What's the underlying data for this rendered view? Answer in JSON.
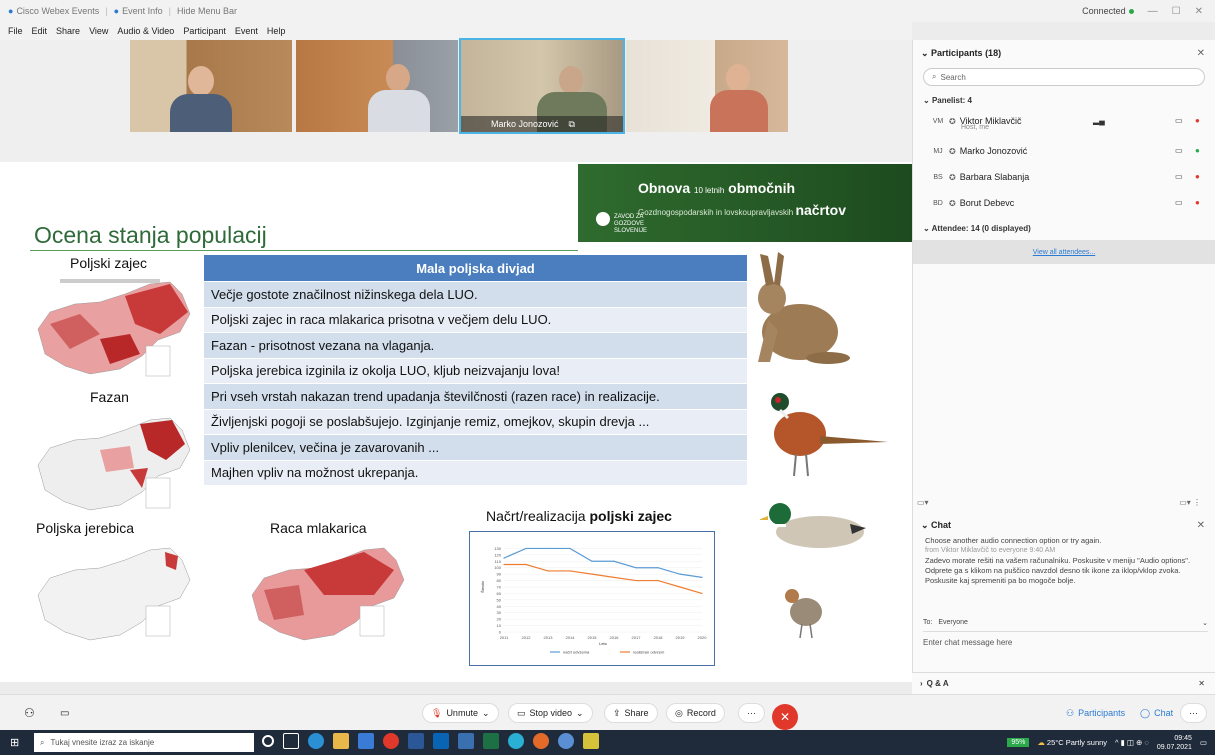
{
  "titlebar": {
    "app": "Cisco Webex Events",
    "event_info": "Event Info",
    "hide_menu": "Hide Menu Bar",
    "connection": "Connected"
  },
  "menu": [
    "File",
    "Edit",
    "Share",
    "View",
    "Audio & Video",
    "Participant",
    "Event",
    "Help"
  ],
  "videos": [
    {
      "name": ""
    },
    {
      "name": ""
    },
    {
      "name": "Marko Jonozović"
    },
    {
      "name": ""
    }
  ],
  "slide": {
    "banner": {
      "line1_a": "Obnova",
      "line1_b": "10 letnih",
      "line1_c": "območnih",
      "line2_a": "Gozdnogospodarskih in lovskoupravljavskih",
      "line2_b": "načrtov",
      "logo_text": "ZAVOD ZA GOZDOVE SLOVENIJE"
    },
    "title": "Ocena stanja populacij",
    "maps": [
      "Poljski zajec",
      "Fazan",
      "Poljska jerebica",
      "Raca mlakarica"
    ],
    "table_header": "Mala poljska divjad",
    "rows": [
      "Večje gostote značilnost nižinskega dela LUO.",
      "Poljski zajec in raca mlakarica prisotna v večjem delu LUO.",
      "Fazan - prisotnost vezana na vlaganja.",
      "Poljska jerebica izginila iz okolja LUO, kljub neizvajanju lova!",
      "Pri vseh vrstah nakazan trend upadanja številčnosti (razen race) in realizacije.",
      "Življenjski pogoji se poslabšujejo. Izginjanje remiz, omejkov, skupin drevja ...",
      "Vpliv plenilcev, večina je zavarovanih ...",
      "Majhen vpliv na možnost ukrepanja."
    ],
    "chart_title_a": "Načrt/realizacija",
    "chart_title_b": "poljski zajec"
  },
  "chart_data": {
    "type": "line",
    "title": "Načrt/realizacija poljski zajec",
    "xlabel": "Leto",
    "ylabel": "Število",
    "x": [
      2011,
      2012,
      2013,
      2014,
      2015,
      2016,
      2017,
      2018,
      2019,
      2020
    ],
    "ylim": [
      0,
      140
    ],
    "yticks": [
      0,
      10,
      20,
      30,
      40,
      50,
      60,
      70,
      80,
      90,
      100,
      110,
      120,
      130
    ],
    "series": [
      {
        "name": "načrt odvzema",
        "color": "#5b9bd5",
        "values": [
          115,
          130,
          130,
          130,
          110,
          110,
          100,
          100,
          90,
          85
        ]
      },
      {
        "name": "realiziran odvzem",
        "color": "#ed7d31",
        "values": [
          105,
          105,
          95,
          95,
          90,
          85,
          80,
          80,
          70,
          60
        ]
      }
    ]
  },
  "panel": {
    "participants_title": "Participants (18)",
    "search_placeholder": "Search",
    "panelist_label": "Panelist: 4",
    "panelists": [
      {
        "initials": "VM",
        "name": "Viktor Miklavčič",
        "sub": "Host, me"
      },
      {
        "initials": "MJ",
        "name": "Marko Jonozović",
        "sub": ""
      },
      {
        "initials": "BS",
        "name": "Barbara Slabanja",
        "sub": ""
      },
      {
        "initials": "BD",
        "name": "Borut Debevc",
        "sub": ""
      }
    ],
    "attendee_label": "Attendee: 14 (0 displayed)",
    "view_all": "View all attendees...",
    "chat_title": "Chat",
    "chat_line1": "Choose another audio connection option or try again.",
    "chat_meta": "from Viktor Miklavčič to everyone   9:40 AM",
    "chat_msg": "Zadevo morate rešiti na vašem računalniku. Poskusite v meniju \"Audio options\". Odprete ga s klikom na puščico navzdol desno tik ikone za iklop/vklop zvoka. Poskusite kaj spremeniti pa bo mogoče bolje.",
    "to_label": "To:",
    "to_value": "Everyone",
    "chat_placeholder": "Enter chat message here",
    "qa_label": "Q & A"
  },
  "toolbar": {
    "unmute": "Unmute",
    "stop_video": "Stop video",
    "share": "Share",
    "record": "Record",
    "participants": "Participants",
    "chat": "Chat"
  },
  "taskbar": {
    "search": "Tukaj vnesite izraz za iskanje",
    "battery": "95%",
    "weather": "25°C  Partly sunny",
    "time": "09:45",
    "date": "09.07.2021"
  }
}
